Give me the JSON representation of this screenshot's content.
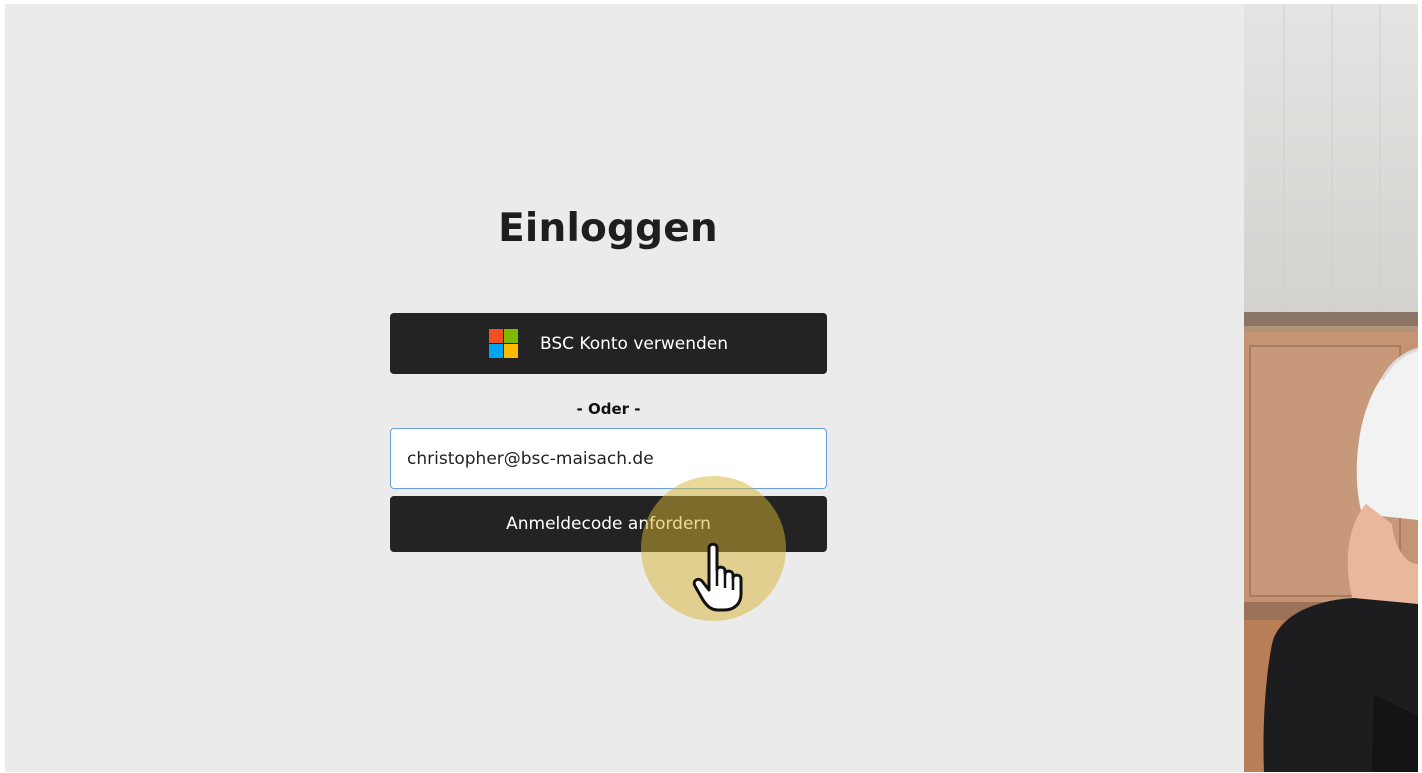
{
  "login": {
    "title": "Einloggen",
    "ms_button_label": "BSC Konto verwenden",
    "or_label": "- Oder -",
    "email_value": "christopher@bsc-maisach.de",
    "request_code_label": "Anmeldecode anfordern"
  },
  "icons": {
    "ms_logo": "microsoft-logo-icon",
    "cursor": "hand-pointer-icon"
  },
  "colors": {
    "background": "#ebebeb",
    "button": "#242324",
    "ms_red": "#f25022",
    "ms_green": "#7fba00",
    "ms_blue": "#00a4ef",
    "ms_yellow": "#ffb900",
    "highlight": "#d6b432"
  }
}
